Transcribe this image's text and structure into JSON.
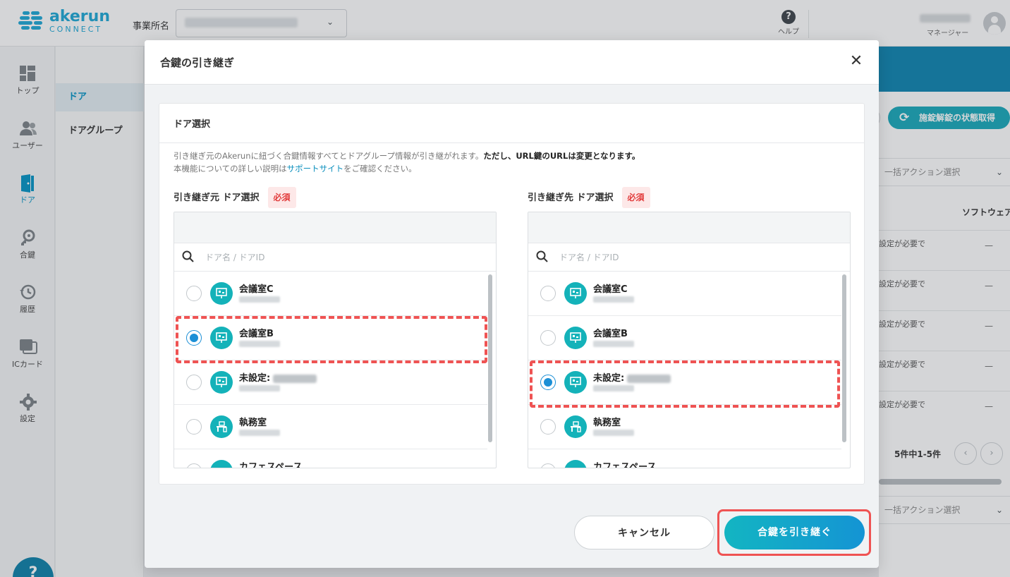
{
  "header": {
    "logo_main": "akerun",
    "logo_sub": "CONNECT",
    "office_label": "事業所名",
    "help_label": "ヘルプ",
    "user_role": "マネージャー"
  },
  "sidebar": {
    "items": [
      {
        "label": "トップ",
        "icon": "grid-icon"
      },
      {
        "label": "ユーザー",
        "icon": "users-icon"
      },
      {
        "label": "ドア",
        "icon": "door-icon"
      },
      {
        "label": "合鍵",
        "icon": "key-icon"
      },
      {
        "label": "履歴",
        "icon": "history-icon"
      },
      {
        "label": "ICカード",
        "icon": "card-icon"
      },
      {
        "label": "設定",
        "icon": "gear-icon"
      }
    ]
  },
  "subnav": {
    "items": [
      {
        "label": "ドア"
      },
      {
        "label": "ドアグループ"
      }
    ]
  },
  "background": {
    "status_button": "施錠解錠の状態取得",
    "bulk_action": "一括アクション選択",
    "column_header": "ソフトウェア",
    "row_text": "設定が必要で",
    "row_dash": "—",
    "pager": "5件中1-5件",
    "prev": "‹",
    "next": "›"
  },
  "modal": {
    "title": "合鍵の引き継ぎ",
    "close": "✕",
    "section_title": "ドア選択",
    "note_line1_a": "引き継ぎ元のAkerunに紐づく合鍵情報すべてとドアグループ情報が引き継がれます。",
    "note_line1_b": "ただし、URL鍵のURLは変更となります。",
    "note_line2_a": "本機能についての詳しい説明は",
    "note_line2_link": "サポートサイト",
    "note_line2_b": "をご確認ください。",
    "required": "必須",
    "search_placeholder": "ドア名 / ドアID",
    "source": {
      "label": "引き継ぎ元 ドア選択",
      "rows": [
        {
          "name": "会議室C",
          "selected": false
        },
        {
          "name": "会議室B",
          "selected": true
        },
        {
          "name": "未設定:",
          "selected": false
        },
        {
          "name": "執務室",
          "selected": false
        },
        {
          "name": "カフェスペース",
          "selected": false
        }
      ]
    },
    "target": {
      "label": "引き継ぎ先 ドア選択",
      "rows": [
        {
          "name": "会議室C",
          "selected": false
        },
        {
          "name": "会議室B",
          "selected": false
        },
        {
          "name": "未設定:",
          "selected": true
        },
        {
          "name": "執務室",
          "selected": false
        },
        {
          "name": "カフェスペース",
          "selected": false
        }
      ]
    },
    "cancel": "キャンセル",
    "submit": "合鍵を引き継ぐ",
    "colors": {
      "accent": "#1494d4",
      "teal": "#13b5c2",
      "highlight": "#ef5353"
    }
  }
}
